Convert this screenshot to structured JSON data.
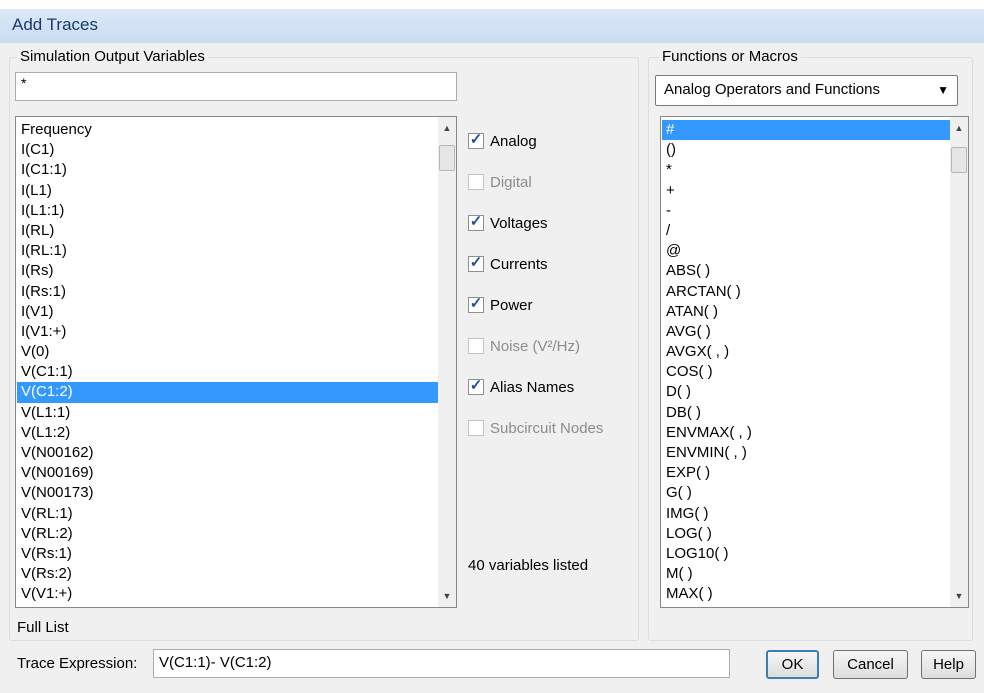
{
  "window": {
    "title": "Add Traces"
  },
  "left": {
    "group_label": "Simulation Output Variables",
    "filter_value": "*",
    "variables": [
      "Frequency",
      "I(C1)",
      "I(C1:1)",
      "I(L1)",
      "I(L1:1)",
      "I(RL)",
      "I(RL:1)",
      "I(Rs)",
      "I(Rs:1)",
      "I(V1)",
      "I(V1:+)",
      "V(0)",
      "V(C1:1)",
      "V(C1:2)",
      "V(L1:1)",
      "V(L1:2)",
      "V(N00162)",
      "V(N00169)",
      "V(N00173)",
      "V(RL:1)",
      "V(RL:2)",
      "V(Rs:1)",
      "V(Rs:2)",
      "V(V1:+)"
    ],
    "selected_index": 13,
    "full_list_label": "Full List"
  },
  "options": [
    {
      "label": "Analog",
      "checked": true,
      "enabled": true
    },
    {
      "label": "Digital",
      "checked": false,
      "enabled": false
    },
    {
      "label": "Voltages",
      "checked": true,
      "enabled": true
    },
    {
      "label": "Currents",
      "checked": true,
      "enabled": true
    },
    {
      "label": "Power",
      "checked": true,
      "enabled": true
    },
    {
      "label": "Noise (V²/Hz)",
      "checked": false,
      "enabled": false
    },
    {
      "label": "Alias Names",
      "checked": true,
      "enabled": true
    },
    {
      "label": "Subcircuit Nodes",
      "checked": false,
      "enabled": false
    }
  ],
  "variables_count_text": "40 variables listed",
  "right": {
    "group_label": "Functions or Macros",
    "dropdown_value": "Analog Operators and Functions",
    "functions": [
      "#",
      "()",
      "*",
      "+",
      "-",
      "/",
      "@",
      "ABS( )",
      "ARCTAN( )",
      "ATAN( )",
      "AVG( )",
      "AVGX( , )",
      "COS( )",
      "D( )",
      "DB( )",
      "ENVMAX( , )",
      "ENVMIN( , )",
      "EXP( )",
      "G( )",
      "IMG( )",
      "LOG( )",
      "LOG10( )",
      "M( )",
      "MAX( )"
    ],
    "selected_index": 0
  },
  "trace": {
    "label": "Trace Expression:",
    "value": "V(C1:1)- V(C1:2)"
  },
  "buttons": {
    "ok": "OK",
    "cancel": "Cancel",
    "help": "Help"
  },
  "colors": {
    "selection": "#3399ff",
    "check": "#1f4f9a",
    "titlebar": "#c9dcf2"
  },
  "icons": {
    "scroll_up": "up-arrow-icon",
    "scroll_down": "down-arrow-icon",
    "check": "check-icon",
    "dropdown": "caret-down-icon"
  }
}
